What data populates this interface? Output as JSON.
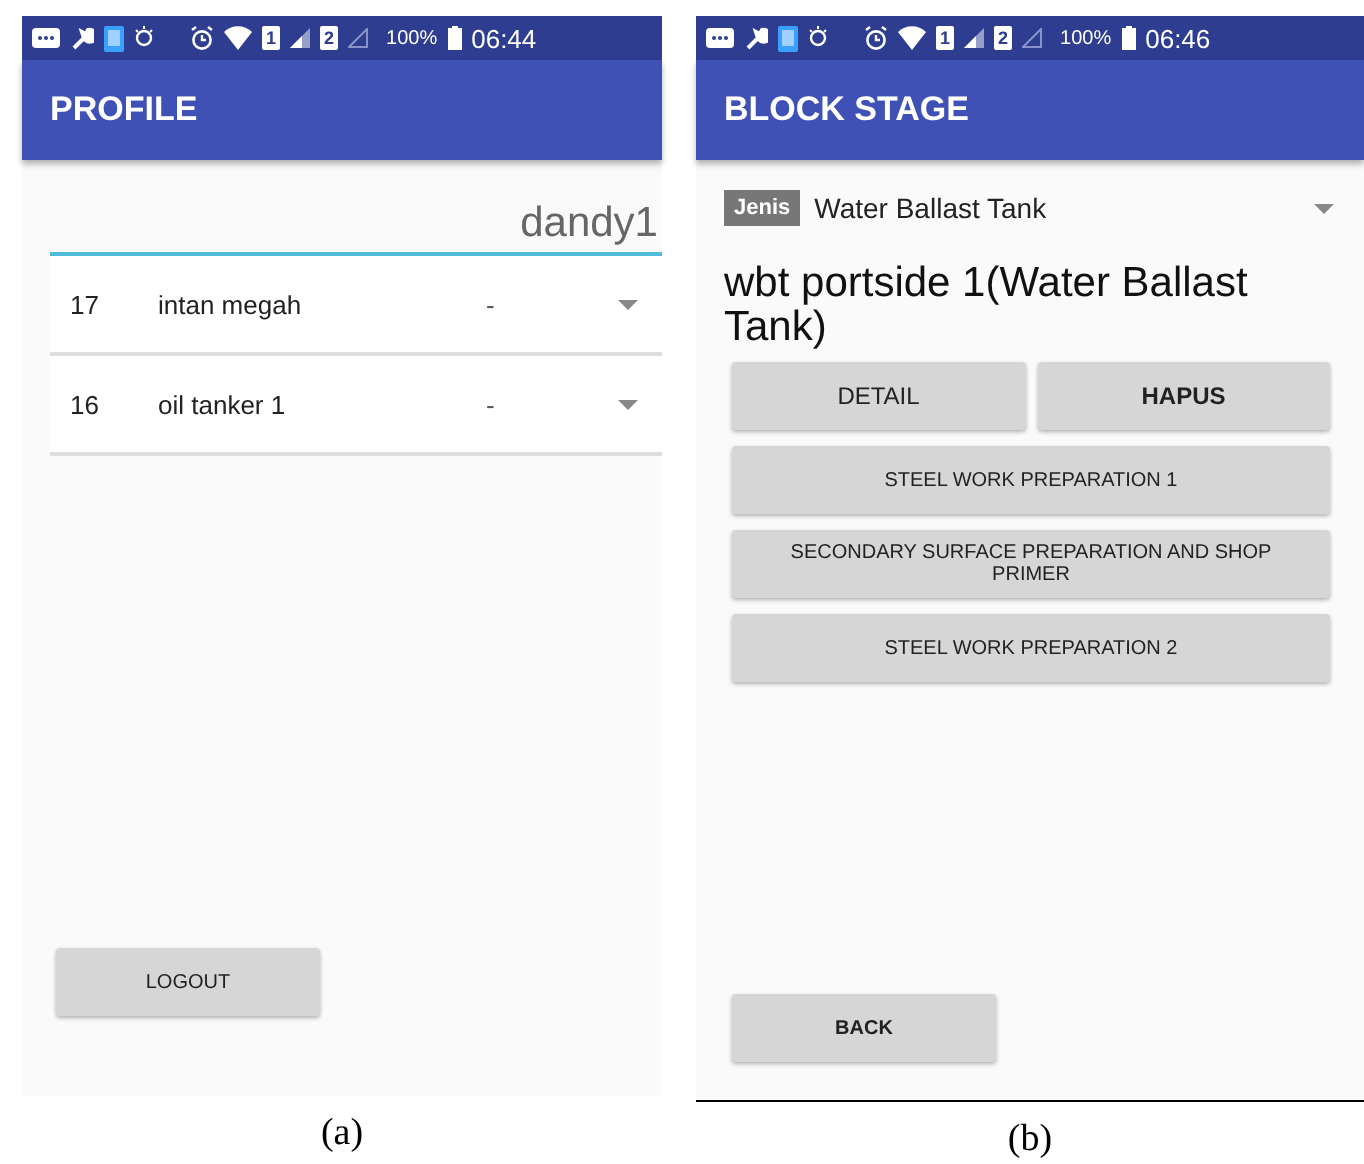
{
  "screens": [
    {
      "caption": "(a)",
      "status_bar": {
        "sim_1": "1",
        "sim_2": "2",
        "battery": "100%",
        "time": "06:44"
      },
      "app_bar": {
        "title": "PROFILE"
      },
      "username": "dandy1",
      "ships": [
        {
          "id": "17",
          "name": "intan megah",
          "status": "-"
        },
        {
          "id": "16",
          "name": "oil tanker 1",
          "status": "-"
        }
      ],
      "footer_button": "LOGOUT",
      "kind": "profile"
    },
    {
      "caption": "(b)",
      "status_bar": {
        "sim_1": "1",
        "sim_2": "2",
        "battery": "100%",
        "time": "06:46"
      },
      "app_bar": {
        "title": "BLOCK STAGE"
      },
      "dropdown": {
        "label": "Jenis",
        "value": "Water Ballast Tank"
      },
      "heading": "wbt portside 1(Water Ballast Tank)",
      "action_buttons": [
        "DETAIL",
        "HAPUS"
      ],
      "stage_buttons": [
        "STEEL WORK PREPARATION 1",
        "SECONDARY SURFACE PREPARATION AND SHOP PRIMER",
        "STEEL WORK PREPARATION 2"
      ],
      "footer_button": "BACK",
      "kind": "block"
    }
  ]
}
